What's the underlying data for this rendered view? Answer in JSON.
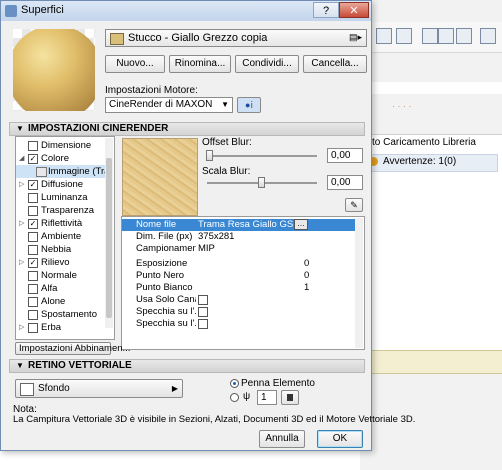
{
  "dialog": {
    "title": "Superfici",
    "help_label": "?",
    "close_label": "✕"
  },
  "material": {
    "name": "Stucco - Giallo Grezzo copia",
    "swatch_color": "#d9bf7a"
  },
  "actions": {
    "new": "Nuovo...",
    "rename": "Rinomina...",
    "share": "Condividi...",
    "delete": "Cancella..."
  },
  "engine": {
    "label": "Impostazioni Motore:",
    "value": "CineRender di MAXON"
  },
  "cinerender": {
    "section_title": "IMPOSTAZIONI CINERENDER",
    "channels": [
      {
        "label": "Dimensione",
        "checked": false
      },
      {
        "label": "Colore",
        "checked": true
      },
      {
        "label": "Immagine (Trama R",
        "sub": true
      },
      {
        "label": "Diffusione",
        "checked": true
      },
      {
        "label": "Luminanza",
        "checked": false
      },
      {
        "label": "Trasparenza",
        "checked": false
      },
      {
        "label": "Riflettività",
        "checked": true
      },
      {
        "label": "Ambiente",
        "checked": false
      },
      {
        "label": "Nebbia",
        "checked": false
      },
      {
        "label": "Rilievo",
        "checked": true
      },
      {
        "label": "Normale",
        "checked": false
      },
      {
        "label": "Alfa",
        "checked": false
      },
      {
        "label": "Alone",
        "checked": false
      },
      {
        "label": "Spostamento",
        "checked": false
      },
      {
        "label": "Erba",
        "checked": false
      }
    ],
    "offset_blur_label": "Offset Blur:",
    "offset_blur_value": "0,00",
    "scale_blur_label": "Scala Blur:",
    "scale_blur_value": "0,00",
    "properties": [
      {
        "name": "Nome file",
        "value": "Trama Resa Giallo GS",
        "selected": true
      },
      {
        "name": "Dim. File (px)",
        "value": "375x281"
      },
      {
        "name": "Campionamen...",
        "value": "MIP"
      },
      {
        "name": "Esposizione",
        "value": "0"
      },
      {
        "name": "Punto Nero",
        "value": "0"
      },
      {
        "name": "Punto Bianco",
        "value": "1"
      },
      {
        "name": "Usa Solo Cana...",
        "value": ""
      },
      {
        "name": "Specchia su l'...",
        "value": ""
      },
      {
        "name": "Specchia su l'...",
        "value": ""
      }
    ],
    "pairing_button": "Impostazioni Abbinamen..."
  },
  "vector": {
    "section_title": "RETINO VETTORIALE",
    "fill_value": "Sfondo",
    "pen_option": "Penna Elemento",
    "pen_number": "1"
  },
  "note": {
    "label": "Nota:",
    "text": "La Campitura Vettoriale 3D è visibile in Sezioni, Alzati, Documenti 3D ed il Motore Vettoriale 3D."
  },
  "footer": {
    "cancel": "Annulla",
    "ok": "OK"
  },
  "background_app": {
    "library_text": "to Caricamento Libreria",
    "warning_text": "Avvertenze: 1(0)",
    "dots": "· · · ·"
  }
}
